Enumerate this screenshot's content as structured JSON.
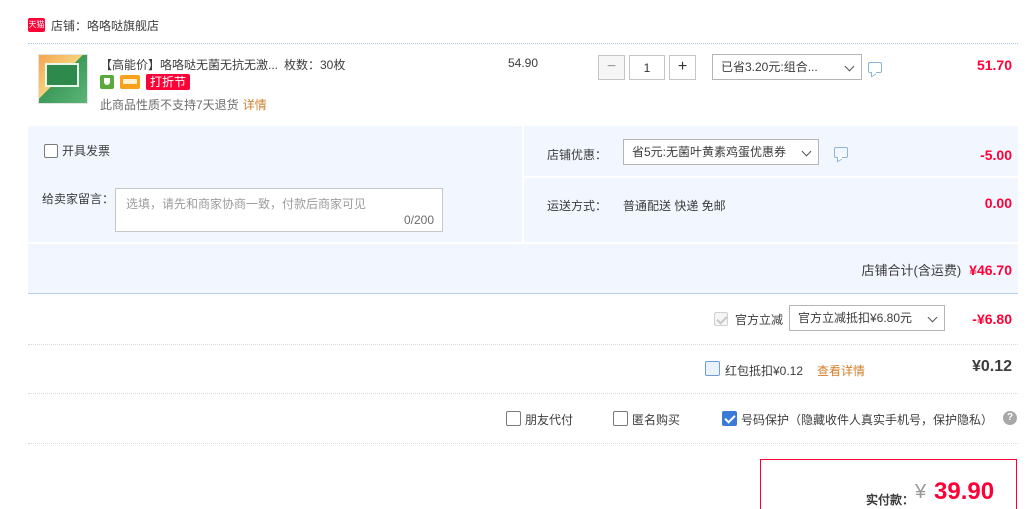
{
  "shop": {
    "badge": "天猫",
    "name": "店铺：咯咯哒旗舰店"
  },
  "item": {
    "title": "【高能价】咯咯哒无菌无抗无激...",
    "spec": "枚数：30枚",
    "promo_tag": "打折节",
    "note": "此商品性质不支持7天退货",
    "note_link": "详情",
    "unit_price": "54.90",
    "quantity": "1",
    "qty_minus": "−",
    "qty_plus": "+",
    "discount_select": "已省3.20元:组合...",
    "subtotal": "51.70"
  },
  "order_panel": {
    "invoice_label": "开具发票",
    "message_label": "给卖家留言：",
    "message_placeholder": "选填，请先和商家协商一致，付款后商家可见",
    "message_count": "0/200",
    "shop_discount_label": "店铺优惠：",
    "shop_discount_select": "省5元:无菌叶黄素鸡蛋优惠券",
    "shop_discount_amount": "-5.00",
    "shipping_label": "运送方式：",
    "shipping_value": "普通配送 快递 免邮",
    "shipping_amount": "0.00",
    "shop_total_label": "店铺合计(含运费)",
    "shop_total_amount": "¥46.70"
  },
  "official": {
    "label": "官方立减",
    "select": "官方立减抵扣¥6.80元",
    "amount": "-¥6.80"
  },
  "redpacket": {
    "label": "红包抵扣¥0.12",
    "link": "查看详情",
    "amount": "¥0.12"
  },
  "options": {
    "friend_pay": "朋友代付",
    "anonymous": "匿名购买",
    "number_protect": "号码保护（隐藏收件人真实手机号，保护隐私）"
  },
  "payment": {
    "label": "实付款：",
    "currency": "¥",
    "amount": "39.90"
  },
  "colors": {
    "accent_red": "#ff0036",
    "panel_blue": "#f2f7ff",
    "link_orange": "#d17f2d",
    "checkbox_blue": "#3a7bd5"
  },
  "icons": [
    "tmall-badge-icon",
    "shield-icon",
    "card-icon",
    "chat-icon",
    "chevron-down-icon",
    "help-icon",
    "check-icon"
  ]
}
